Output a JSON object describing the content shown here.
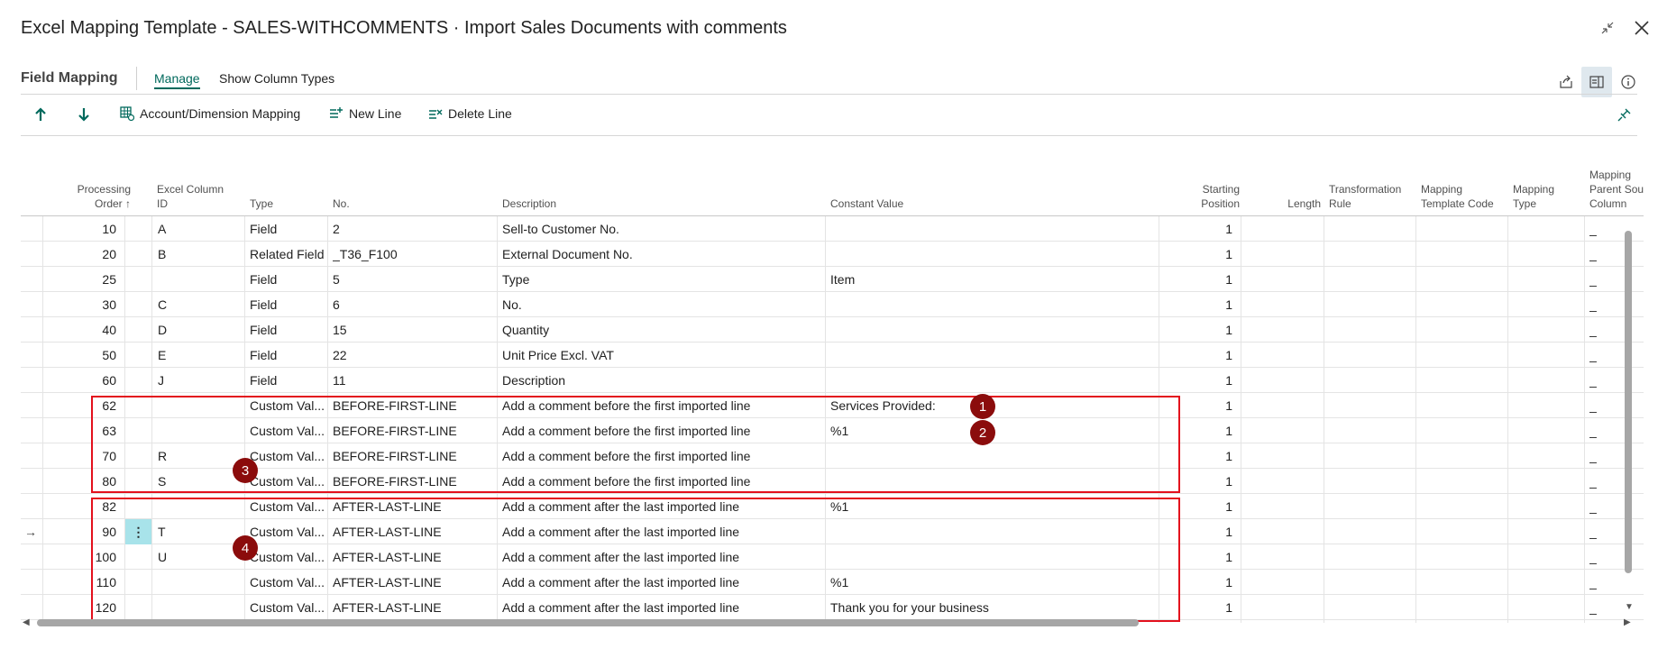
{
  "window": {
    "title": "Excel Mapping Template - SALES-WITHCOMMENTS · Import Sales Documents with comments"
  },
  "tabs": {
    "page_label": "Field Mapping",
    "items": [
      {
        "label": "Manage",
        "active": true
      },
      {
        "label": "Show Column Types",
        "active": false
      }
    ]
  },
  "actions": {
    "account_dimension": "Account/Dimension Mapping",
    "new_line": "New Line",
    "delete_line": "Delete Line"
  },
  "columns": {
    "processing_order": [
      "Processing",
      "Order ↑"
    ],
    "excel_column_id": [
      "Excel Column",
      "ID"
    ],
    "type": [
      "Type"
    ],
    "no": [
      "No."
    ],
    "description": [
      "Description"
    ],
    "constant_value": [
      "Constant Value"
    ],
    "starting_position": [
      "Starting",
      "Position"
    ],
    "length": [
      "Length"
    ],
    "transformation_rule": [
      "Transformation",
      "Rule"
    ],
    "mapping_template_code": [
      "Mapping",
      "Template Code"
    ],
    "mapping_type": [
      "Mapping",
      "Type"
    ],
    "mapping_parent_source_column": [
      "Mapping",
      "Parent Sourc",
      "Column"
    ]
  },
  "rows": [
    {
      "order": "10",
      "col": "A",
      "type": "Field",
      "no": "2",
      "desc": "Sell-to Customer No.",
      "const": "",
      "start": "1",
      "parent": "_"
    },
    {
      "order": "20",
      "col": "B",
      "type": "Related Field",
      "no": "_T36_F100",
      "desc": "External Document No.",
      "const": "",
      "start": "1",
      "parent": "_"
    },
    {
      "order": "25",
      "col": "",
      "type": "Field",
      "no": "5",
      "desc": "Type",
      "const": "Item",
      "start": "1",
      "parent": "_"
    },
    {
      "order": "30",
      "col": "C",
      "type": "Field",
      "no": "6",
      "desc": "No.",
      "const": "",
      "start": "1",
      "parent": "_"
    },
    {
      "order": "40",
      "col": "D",
      "type": "Field",
      "no": "15",
      "desc": "Quantity",
      "const": "",
      "start": "1",
      "parent": "_"
    },
    {
      "order": "50",
      "col": "E",
      "type": "Field",
      "no": "22",
      "desc": "Unit Price Excl. VAT",
      "const": "",
      "start": "1",
      "parent": "_"
    },
    {
      "order": "60",
      "col": "J",
      "type": "Field",
      "no": "11",
      "desc": "Description",
      "const": "",
      "start": "1",
      "parent": "_"
    },
    {
      "order": "62",
      "col": "",
      "type": "Custom Val...",
      "no": "BEFORE-FIRST-LINE",
      "desc": "Add a comment before the first imported line",
      "const": "Services Provided:",
      "start": "1",
      "parent": "_"
    },
    {
      "order": "63",
      "col": "",
      "type": "Custom Val...",
      "no": "BEFORE-FIRST-LINE",
      "desc": "Add a comment before the first imported line",
      "const": "%1",
      "start": "1",
      "parent": "_"
    },
    {
      "order": "70",
      "col": "R",
      "type": "Custom Val...",
      "no": "BEFORE-FIRST-LINE",
      "desc": "Add a comment before the first imported line",
      "const": "",
      "start": "1",
      "parent": "_"
    },
    {
      "order": "80",
      "col": "S",
      "type": "Custom Val...",
      "no": "BEFORE-FIRST-LINE",
      "desc": "Add a comment before the first imported line",
      "const": "",
      "start": "1",
      "parent": "_"
    },
    {
      "order": "82",
      "col": "",
      "type": "Custom Val...",
      "no": "AFTER-LAST-LINE",
      "desc": "Add a comment after the last imported line",
      "const": "%1",
      "start": "1",
      "parent": "_"
    },
    {
      "order": "90",
      "col": "T",
      "type": "Custom Val...",
      "no": "AFTER-LAST-LINE",
      "desc": "Add a comment after the last imported line",
      "const": "",
      "start": "1",
      "parent": "_",
      "current": true
    },
    {
      "order": "100",
      "col": "U",
      "type": "Custom Val...",
      "no": "AFTER-LAST-LINE",
      "desc": "Add a comment after the last imported line",
      "const": "",
      "start": "1",
      "parent": "_"
    },
    {
      "order": "110",
      "col": "",
      "type": "Custom Val...",
      "no": "AFTER-LAST-LINE",
      "desc": "Add a comment after the last imported line",
      "const": "%1",
      "start": "1",
      "parent": "_"
    },
    {
      "order": "120",
      "col": "",
      "type": "Custom Val...",
      "no": "AFTER-LAST-LINE",
      "desc": "Add a comment after the last imported line",
      "const": "Thank you for your business",
      "start": "1",
      "parent": "_"
    }
  ],
  "badges": [
    "1",
    "2",
    "3",
    "4"
  ],
  "colors": {
    "accent": "#00695c",
    "highlight_box": "#e3101d",
    "badge": "#8b0c0c",
    "current_row_cell": "#a8e3ea"
  }
}
